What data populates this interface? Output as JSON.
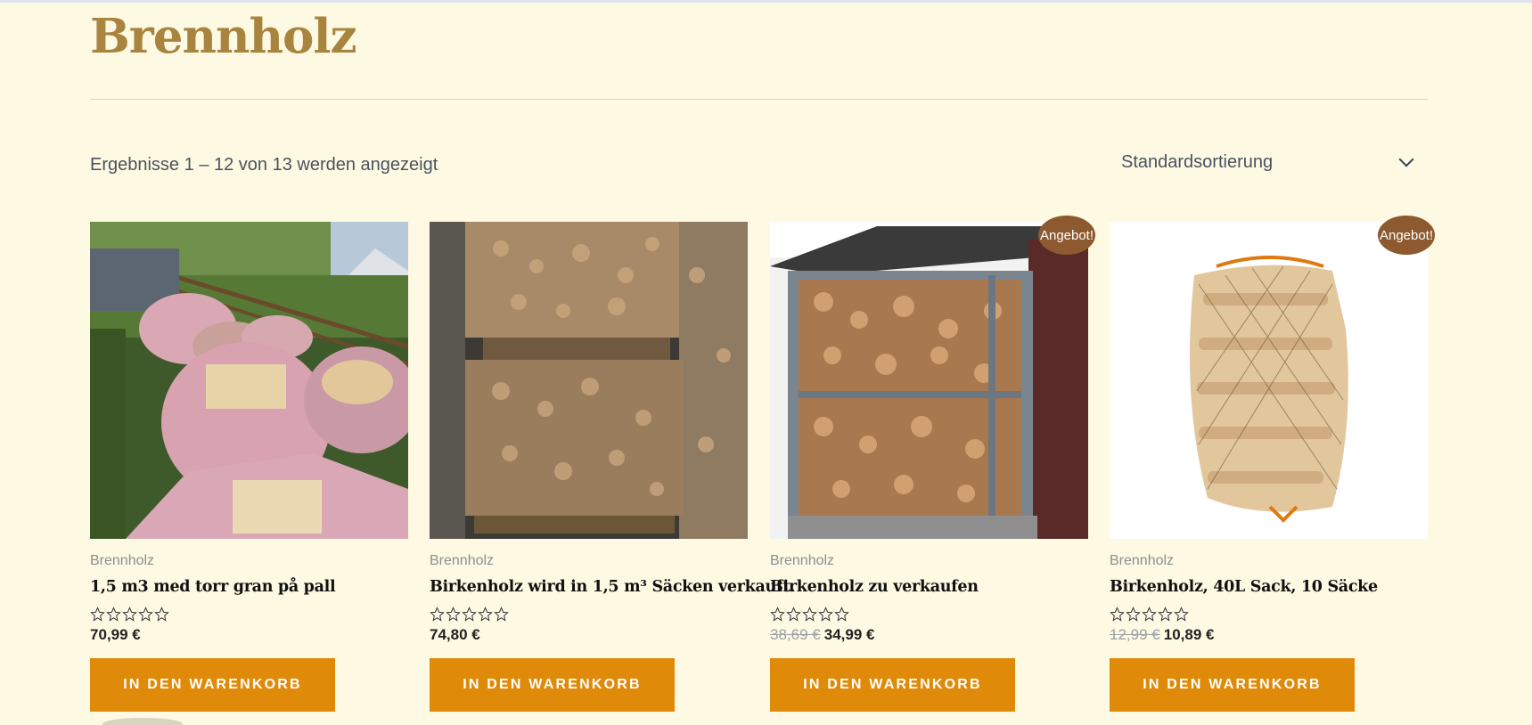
{
  "page": {
    "title": "Brennholz"
  },
  "toolbar": {
    "results_text": "Ergebnisse 1 – 12 von 13 werden angezeigt",
    "sort_selected": "Standardsortierung"
  },
  "products": [
    {
      "category": "Brennholz",
      "name": "1,5 m3 med torr gran på pall",
      "rating": 0,
      "price": "70,99 €",
      "old_price": "",
      "badge": "",
      "cart_label": "IN DEN WARENKORB",
      "image": "bags-of-firewood-on-grass-photo"
    },
    {
      "category": "Brennholz",
      "name": "Birkenholz wird in 1,5 m³ Säcken verkauft.",
      "rating": 0,
      "price": "74,80 €",
      "old_price": "",
      "badge": "",
      "cart_label": "IN DEN WARENKORB",
      "image": "firewood-pallets-in-shed-photo"
    },
    {
      "category": "Brennholz",
      "name": "Birkenholz zu verkaufen",
      "rating": 0,
      "price": "34,99 €",
      "old_price": "38,69 €",
      "badge": "Angebot!",
      "cart_label": "IN DEN WARENKORB",
      "image": "firewood-in-metal-rack-photo"
    },
    {
      "category": "Brennholz",
      "name": "Birkenholz, 40L Sack, 10 Säcke",
      "rating": 0,
      "price": "10,89 €",
      "old_price": "12,99 €",
      "badge": "Angebot!",
      "cart_label": "IN DEN WARENKORB",
      "image": "firewood-net-sack-photo"
    }
  ],
  "colors": {
    "background": "#fdf9e2",
    "title": "#a8843f",
    "button": "#e08a0a",
    "badge": "#8d5a30"
  }
}
